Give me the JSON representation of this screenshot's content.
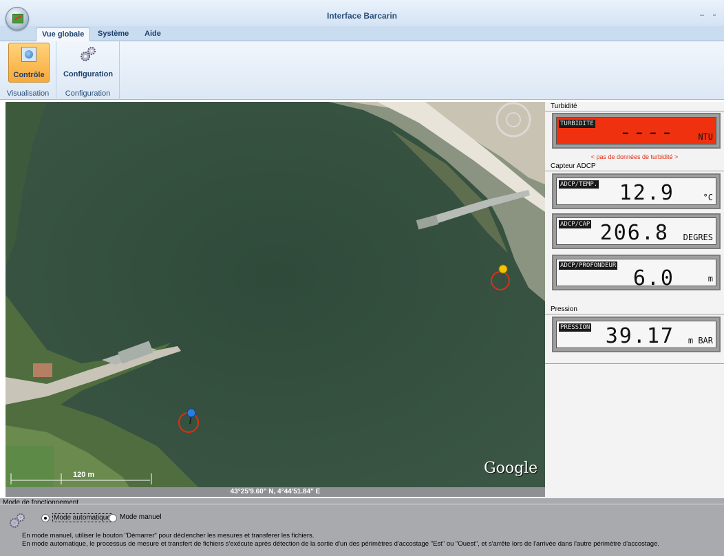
{
  "window": {
    "title": "Interface Barcarin",
    "minimize": "–",
    "maximize": "▫"
  },
  "tabs": [
    {
      "label": "Vue globale",
      "active": true
    },
    {
      "label": "Système",
      "active": false
    },
    {
      "label": "Aide",
      "active": false
    }
  ],
  "ribbon": {
    "groups": [
      {
        "label": "Visualisation",
        "button": "Contrôle",
        "icon": "globe-icon",
        "selected": true
      },
      {
        "label": "Configuration",
        "button": "Configuration",
        "icon": "gears-icon",
        "selected": false
      }
    ]
  },
  "map": {
    "scale_label": "120 m",
    "provider": "Google",
    "coordinates": "43°25'9.60\" N,  4°44'51.84\" E",
    "markers": [
      {
        "name": "yellow-pin",
        "color": "#f5c400"
      },
      {
        "name": "blue-pin",
        "color": "#2a7de0"
      }
    ]
  },
  "panel": {
    "turbidity": {
      "section": "Turbidité",
      "tag": "TURBIDITE",
      "value": "----",
      "unit": "NTU",
      "status": "< pas de données de turbidité >",
      "color": "#f0310f"
    },
    "adcp": {
      "section": "Capteur ADCP",
      "temp": {
        "tag": "ADCP/TEMP.",
        "value": "12.9",
        "unit": "°C"
      },
      "cap": {
        "tag": "ADCP/CAP",
        "value": "206.8",
        "unit": "DEGRES"
      },
      "depth": {
        "tag": "ADCP/PROFONDEUR",
        "value": "6.0",
        "unit": "m"
      }
    },
    "pressure": {
      "section": "Pression",
      "tag": "PRESSION",
      "value": "39.17",
      "unit": "m BAR"
    }
  },
  "mode": {
    "title": "Mode de fonctionnement",
    "auto_label": "Mode automatique",
    "manual_label": "Mode manuel",
    "selected": "auto",
    "hint_manual": "En mode manuel, utiliser le bouton \"Démarrer\" pour déclencher les mesures et transferer les fichiers.",
    "hint_auto": "En mode automatique, le processus de mesure et transfert de fichiers s'exécute après détection de la sortie d'un des périmètres d'accostage \"Est\" ou \"Ouest\", et s'arrête lors de l'arrivée dans l'autre périmètre d'accostage."
  }
}
